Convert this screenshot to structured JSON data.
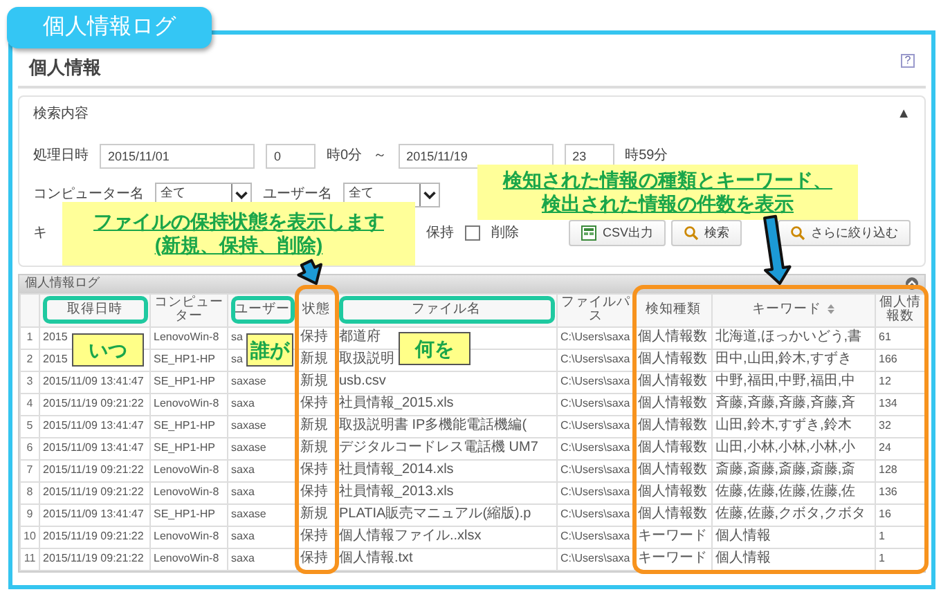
{
  "title_tab": "個人情報ログ",
  "page": {
    "title": "個人情報",
    "help": "?"
  },
  "search": {
    "title": "検索内容",
    "collapse": "▲",
    "date_label": "処理日時",
    "from_date": "2015/11/01",
    "from_hour": "0",
    "from_suffix": "時0分",
    "range_sep": "～",
    "to_date": "2015/11/19",
    "to_hour": "23",
    "to_suffix": "時59分",
    "computer_label": "コンピューター名",
    "computer_value": "全て",
    "user_label": "ユーザー名",
    "user_value": "全て",
    "keyword_label": "キ",
    "status_filters": [
      {
        "label": "保持"
      },
      {
        "label": "削除",
        "checked": false
      }
    ],
    "buttons": [
      {
        "label": "CSV出力",
        "kind": "csv"
      },
      {
        "label": "検索",
        "kind": "search"
      },
      {
        "label": "さらに絞り込む",
        "kind": "filter"
      }
    ]
  },
  "grid": {
    "title": "個人情報ログ",
    "columns": [
      {
        "label": "取得日時",
        "sortable": false,
        "kind": "header_frame",
        "tag": "いつ"
      },
      {
        "label": "コンピューター",
        "sortable": false,
        "kind": "plain"
      },
      {
        "label": "ユーザー",
        "sortable": false,
        "kind": "header_frame",
        "tag": "誰が"
      },
      {
        "label": "状態",
        "sortable": false,
        "kind": "column_frame"
      },
      {
        "label": "ファイル名",
        "sortable": false,
        "kind": "header_frame",
        "tag": "何を"
      },
      {
        "label": "ファイルパス",
        "sortable": false,
        "kind": "plain"
      },
      {
        "label": "検知種類",
        "sortable": false,
        "kind": "column_frame"
      },
      {
        "label": "キーワード",
        "sortable": true,
        "kind": "column_frame"
      },
      {
        "label": "個人情報数",
        "sortable": false,
        "kind": "column_frame"
      }
    ],
    "rows": [
      {
        "no": "1",
        "cells": [
          "2015",
          "LenovoWin-8",
          "sa",
          "保持",
          "都道府",
          "C:\\Users\\saxa",
          "個人情報数",
          "北海道,ほっかいどう,書",
          "61"
        ]
      },
      {
        "no": "2",
        "cells": [
          "2015",
          "SE_HP1-HP",
          "sa",
          "新規",
          "取扱説明",
          "C:\\Users\\saxa",
          "個人情報数",
          "田中,山田,鈴木,すずき",
          "166"
        ]
      },
      {
        "no": "3",
        "cells": [
          "2015/11/09 13:41:47",
          "SE_HP1-HP",
          "saxase",
          "新規",
          "usb.csv",
          "C:\\Users\\saxa",
          "個人情報数",
          "中野,福田,中野,福田,中",
          "12"
        ]
      },
      {
        "no": "4",
        "cells": [
          "2015/11/19 09:21:22",
          "LenovoWin-8",
          "saxa",
          "保持",
          "社員情報_2015.xls",
          "C:\\Users\\saxa",
          "個人情報数",
          "斉藤,斉藤,斉藤,斉藤,斉",
          "134"
        ]
      },
      {
        "no": "5",
        "cells": [
          "2015/11/09 13:41:47",
          "SE_HP1-HP",
          "saxase",
          "新規",
          "取扱説明書 IP多機能電話機編(",
          "C:\\Users\\saxa",
          "個人情報数",
          "山田,鈴木,すずき,鈴木",
          "32"
        ]
      },
      {
        "no": "6",
        "cells": [
          "2015/11/09 13:41:47",
          "SE_HP1-HP",
          "saxase",
          "新規",
          "デジタルコードレス電話機 UM7",
          "C:\\Users\\saxa",
          "個人情報数",
          "山田,小林,小林,小林,小",
          "24"
        ]
      },
      {
        "no": "7",
        "cells": [
          "2015/11/19 09:21:22",
          "LenovoWin-8",
          "saxa",
          "保持",
          "社員情報_2014.xls",
          "C:\\Users\\saxa",
          "個人情報数",
          "斎藤,斎藤,斎藤,斎藤,斎",
          "128"
        ]
      },
      {
        "no": "8",
        "cells": [
          "2015/11/19 09:21:22",
          "LenovoWin-8",
          "saxa",
          "保持",
          "社員情報_2013.xls",
          "C:\\Users\\saxa",
          "個人情報数",
          "佐藤,佐藤,佐藤,佐藤,佐",
          "136"
        ]
      },
      {
        "no": "9",
        "cells": [
          "2015/11/09 13:41:47",
          "SE_HP1-HP",
          "saxase",
          "新規",
          "PLATIA販売マニュアル(縮版).p",
          "C:\\Users\\saxa",
          "個人情報数",
          "佐藤,佐藤,クボタ,クボタ",
          "16"
        ]
      },
      {
        "no": "10",
        "cells": [
          "2015/11/19 09:21:22",
          "LenovoWin-8",
          "saxa",
          "保持",
          "個人情報ファイル..xlsx",
          "C:\\Users\\saxa",
          "キーワード",
          "個人情報",
          "1"
        ]
      },
      {
        "no": "11",
        "cells": [
          "2015/11/19 09:21:22",
          "LenovoWin-8",
          "saxa",
          "保持",
          "個人情報.txt",
          "C:\\Users\\saxa",
          "キーワード",
          "個人情報",
          "1"
        ]
      }
    ]
  },
  "callouts": [
    {
      "lines": [
        "ファイルの保持状態を表示します",
        "(新規、保持、削除)"
      ]
    },
    {
      "lines": [
        "検知された情報の種類とキーワード、",
        "検出された情報の件数を表示"
      ]
    }
  ]
}
